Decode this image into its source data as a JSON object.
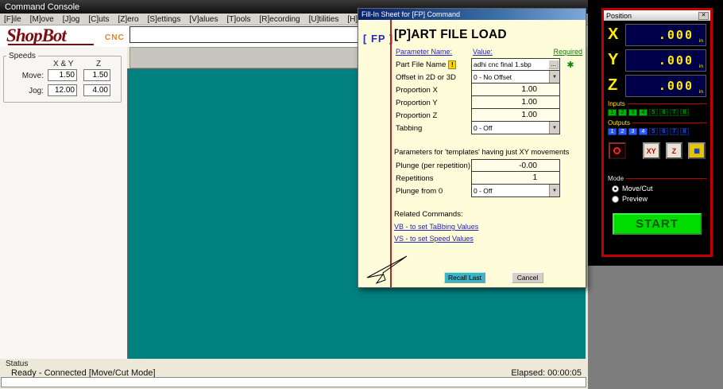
{
  "window": {
    "title": "Command Console"
  },
  "menu": [
    "[F]ile",
    "[M]ove",
    "[J]og",
    "[C]uts",
    "[Z]ero",
    "[S]ettings",
    "[V]alues",
    "[T]ools",
    "[R]ecording",
    "[U]tilities",
    "[H]elp"
  ],
  "logo": {
    "brand": "ShopBot",
    "sub": "CNC"
  },
  "command_input": {
    "value": ""
  },
  "speeds": {
    "title": "Speeds",
    "col_xy": "X & Y",
    "col_z": "Z",
    "move_label": "Move:",
    "move_xy": "1.50",
    "move_z": "1.50",
    "jog_label": "Jog:",
    "jog_xy": "12.00",
    "jog_z": "4.00"
  },
  "status": {
    "label": "Status",
    "text": "Ready - Connected  [Move/Cut Mode]",
    "elapsed": "Elapsed: 00:00:05"
  },
  "dialog": {
    "title": "Fill-In Sheet for [FP] Command",
    "command_code": "[ FP ]",
    "heading": "[P]ART FILE LOAD",
    "col_param": "Parameter Name:",
    "col_value": "Value:",
    "col_required": "Required",
    "warn_icon": "!",
    "browse_label": "...",
    "required_star": "✱",
    "dropdown_glyph": "▼",
    "rows": [
      {
        "label": "Part File Name",
        "value": "adhi cnc final 1.sbp"
      },
      {
        "label": "Offset in 2D or 3D",
        "value": "0 - No Offset"
      },
      {
        "label": "Proportion X",
        "value": "1.00"
      },
      {
        "label": "Proportion Y",
        "value": "1.00"
      },
      {
        "label": "Proportion Z",
        "value": "1.00"
      },
      {
        "label": "Tabbing",
        "value": "0 - Off"
      }
    ],
    "section2_title": "Parameters for 'templates' having just XY movements",
    "rows2": [
      {
        "label": "Plunge (per repetition)",
        "value": "-0.00"
      },
      {
        "label": "Repetitions",
        "value": "1"
      },
      {
        "label": "Plunge from 0",
        "value": "0 - Off"
      }
    ],
    "related_title": "Related Commands:",
    "links": [
      "VB - to set TaBbing Values",
      "VS - to set Speed Values"
    ],
    "recall_button": "Recall Last",
    "cancel_button": "Cancel"
  },
  "position": {
    "title": "Position",
    "close_glyph": "✕",
    "axes": [
      {
        "label": "X",
        "value": ".000",
        "unit": "in"
      },
      {
        "label": "Y",
        "value": ".000",
        "unit": "in"
      },
      {
        "label": "Z",
        "value": ".000",
        "unit": "in"
      }
    ],
    "inputs_label": "Inputs",
    "outputs_label": "Outputs",
    "input_leds": [
      "1",
      "2",
      "3",
      "4",
      "5",
      "6",
      "7",
      "8"
    ],
    "output_leds": [
      "1",
      "2",
      "3",
      "4",
      "5",
      "6",
      "7",
      "8"
    ],
    "buttons": {
      "zero_xy": "XY",
      "zero_z": "Z",
      "edge": "▦"
    },
    "mode_label": "Mode",
    "mode_options": [
      "Move/Cut",
      "Preview"
    ],
    "start_button": "START"
  },
  "colors": {
    "canvas_teal": "#00807e",
    "dialog_bg": "#fffcd9",
    "accent_red": "#c00000",
    "start_green": "#00dc00",
    "readout_yellow": "#ffee00"
  }
}
